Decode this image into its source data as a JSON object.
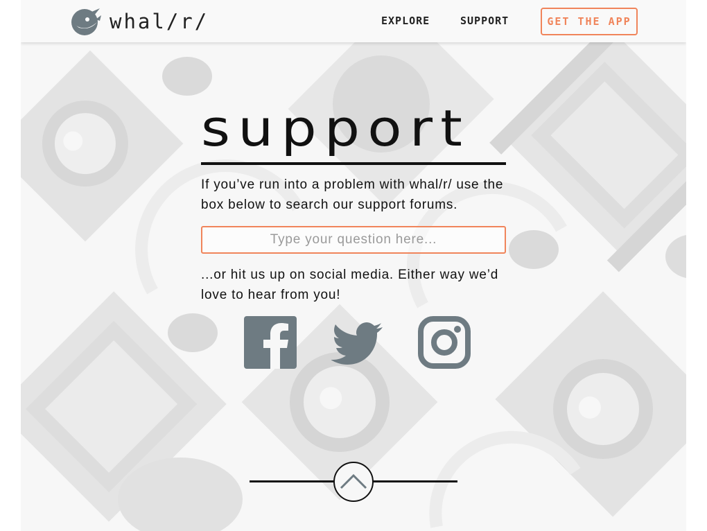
{
  "header": {
    "logo_text": "whal/r/",
    "nav": [
      {
        "label": "EXPLORE"
      },
      {
        "label": "SUPPORT"
      }
    ],
    "cta_label": "GET THE APP"
  },
  "main": {
    "title": "support",
    "intro": "If you’ve run into a problem with whal/r/ use the box below to search our support forums.",
    "search_placeholder": "Type your question here...",
    "social_text": "...or hit us up on social media. Either way we’d love to hear from you!",
    "social": [
      {
        "icon": "facebook-icon"
      },
      {
        "icon": "twitter-icon"
      },
      {
        "icon": "instagram-icon"
      }
    ]
  },
  "colors": {
    "accent": "#f0845a",
    "icon": "#6e7b82",
    "text": "#111111",
    "background": "#f7f7f7"
  },
  "footer": {
    "scroll_icon": "chevron-up-icon"
  }
}
